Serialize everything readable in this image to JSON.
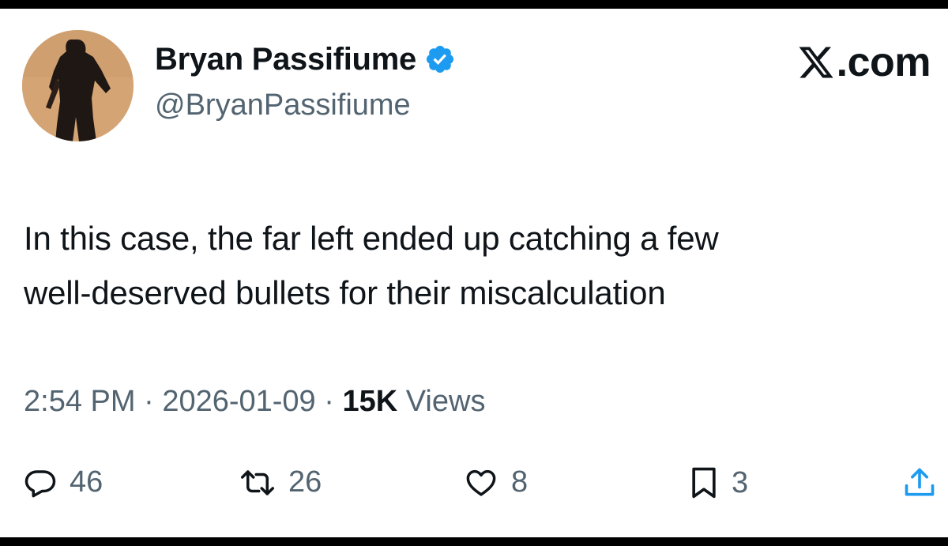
{
  "author": {
    "display_name": "Bryan Passifiume",
    "handle": "@BryanPassifiume",
    "verified": true,
    "verified_color": "#1d9bf0"
  },
  "brand": {
    "label": ".com",
    "icon": "x-logo-icon"
  },
  "tweet": {
    "line1": "In this case, the far left ended up catching a few",
    "line2": "well-deserved bullets for their miscalculation"
  },
  "meta": {
    "time": "2:54 PM",
    "separator": " · ",
    "date": "2026-01-09",
    "views_count": "15K",
    "views_label": " Views"
  },
  "actions": {
    "replies": "46",
    "retweets": "26",
    "likes": "8",
    "bookmarks": "3"
  },
  "colors": {
    "text": "#0f1419",
    "muted": "#536471",
    "background": "#ffffff",
    "accent": "#1d9bf0"
  }
}
